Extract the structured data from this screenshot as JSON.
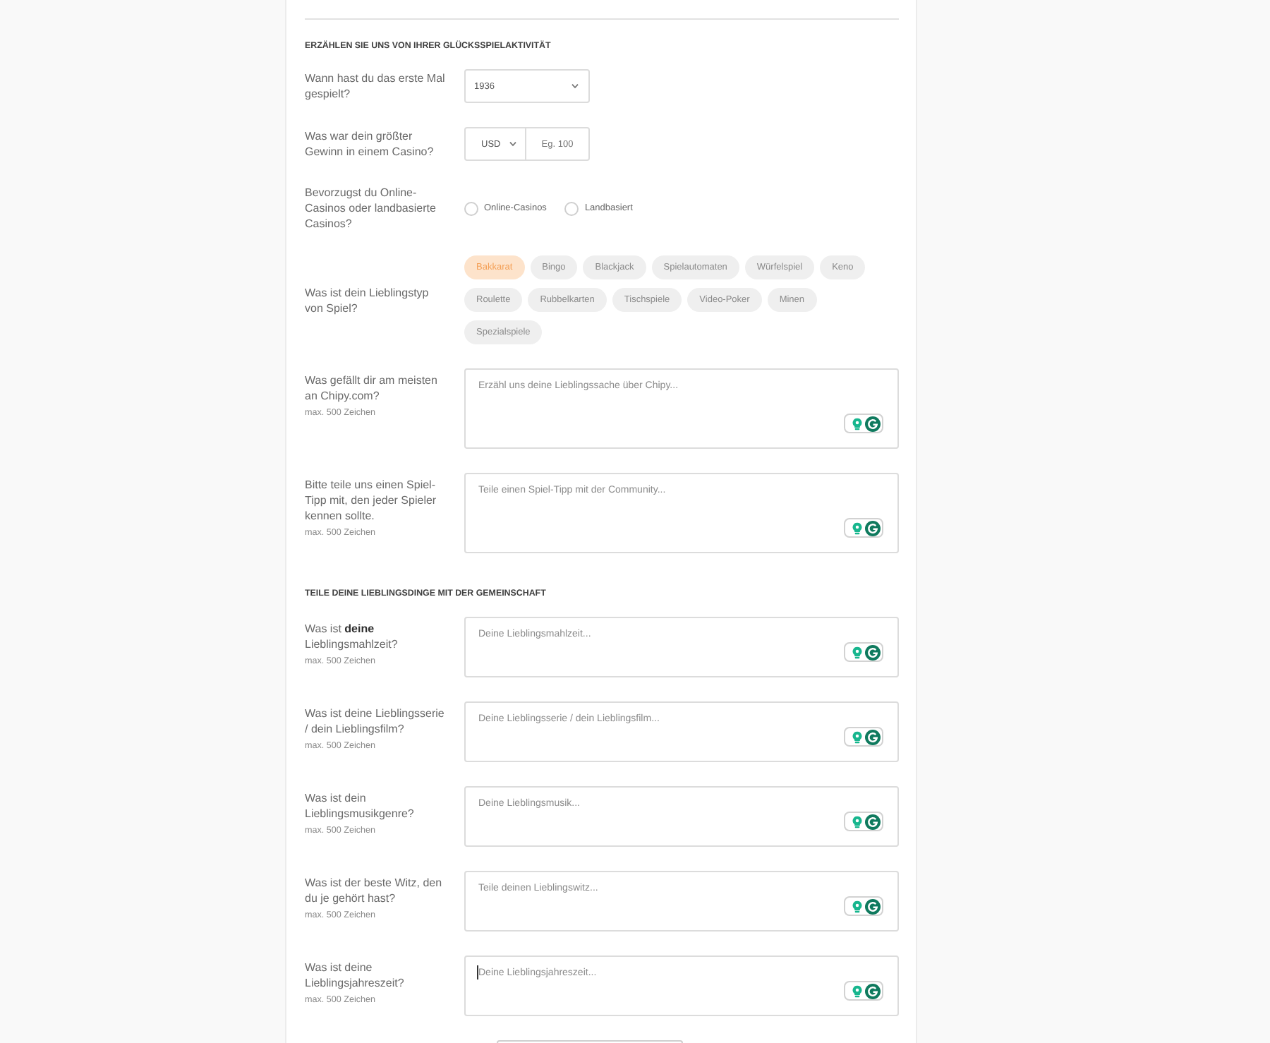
{
  "sections": [
    {
      "heading": "ERZÄHLEN SIE UNS VON IHRER GLÜCKSSPIELAKTIVITÄT",
      "fields": [
        {
          "kind": "select",
          "label": "Wann hast du das erste Mal gespielt?",
          "value": "1936"
        },
        {
          "kind": "money",
          "label": "Was war dein größter Gewinn in einem Casino?",
          "currency": "USD",
          "placeholder": "Eg. 100"
        },
        {
          "kind": "radio",
          "label": "Bevorzugst du Online-Casinos oder landbasierte Casinos?",
          "options": [
            {
              "label": "Online-Casinos",
              "selected": false
            },
            {
              "label": "Landbasiert",
              "selected": false
            }
          ]
        },
        {
          "kind": "chips",
          "label": "Was ist dein Lieblingstyp von Spiel?",
          "options": [
            {
              "label": "Bakkarat",
              "selected": true
            },
            {
              "label": "Bingo",
              "selected": false
            },
            {
              "label": "Blackjack",
              "selected": false
            },
            {
              "label": "Spielautomaten",
              "selected": false
            },
            {
              "label": "Würfelspiel",
              "selected": false
            },
            {
              "label": "Keno",
              "selected": false
            },
            {
              "label": "Roulette",
              "selected": false
            },
            {
              "label": "Rubbelkarten",
              "selected": false
            },
            {
              "label": "Tischspiele",
              "selected": false
            },
            {
              "label": "Video-Poker",
              "selected": false
            },
            {
              "label": "Minen",
              "selected": false
            },
            {
              "label": "Spezialspiele",
              "selected": false
            }
          ]
        },
        {
          "kind": "textarea",
          "label": "Was gefällt dir am meisten an Chipy.com?",
          "hint": "max. 500 Zeichen",
          "placeholder": "Erzähl uns deine Lieblingssache über Chipy...",
          "focused": false
        },
        {
          "kind": "textarea",
          "label": "Bitte teile uns einen Spiel-Tipp mit, den jeder Spieler kennen sollte.",
          "hint": "max. 500 Zeichen",
          "placeholder": "Teile einen Spiel-Tipp mit der Community...",
          "focused": false
        }
      ]
    },
    {
      "heading": "TEILE DEINE LIEBLINGSDINGE MIT DER GEMEINSCHAFT",
      "fields": [
        {
          "kind": "textarea",
          "label": "Was ist **deine** Lieblingsmahlzeit?",
          "hint": "max. 500 Zeichen",
          "placeholder": "Deine Lieblingsmahlzeit...",
          "focused": false
        },
        {
          "kind": "textarea",
          "label": "Was ist deine Lieblingsserie / dein Lieblingsfilm?",
          "hint": "max. 500 Zeichen",
          "placeholder": "Deine Lieblingsserie / dein Lieblingsfilm...",
          "focused": false
        },
        {
          "kind": "textarea",
          "label": "Was ist dein Lieblingsmusikgenre?",
          "hint": "max. 500 Zeichen",
          "placeholder": "Deine Lieblingsmusik...",
          "focused": false
        },
        {
          "kind": "textarea",
          "label": "Was ist der beste Witz, den du je gehört hast?",
          "hint": "max. 500 Zeichen",
          "placeholder": "Teile deinen Lieblingswitz...",
          "focused": false
        },
        {
          "kind": "textarea",
          "label": "Was ist deine Lieblingsjahreszeit?",
          "hint": "max. 500 Zeichen",
          "placeholder": "Deine Lieblingsjahreszeit...",
          "focused": true
        }
      ]
    }
  ]
}
